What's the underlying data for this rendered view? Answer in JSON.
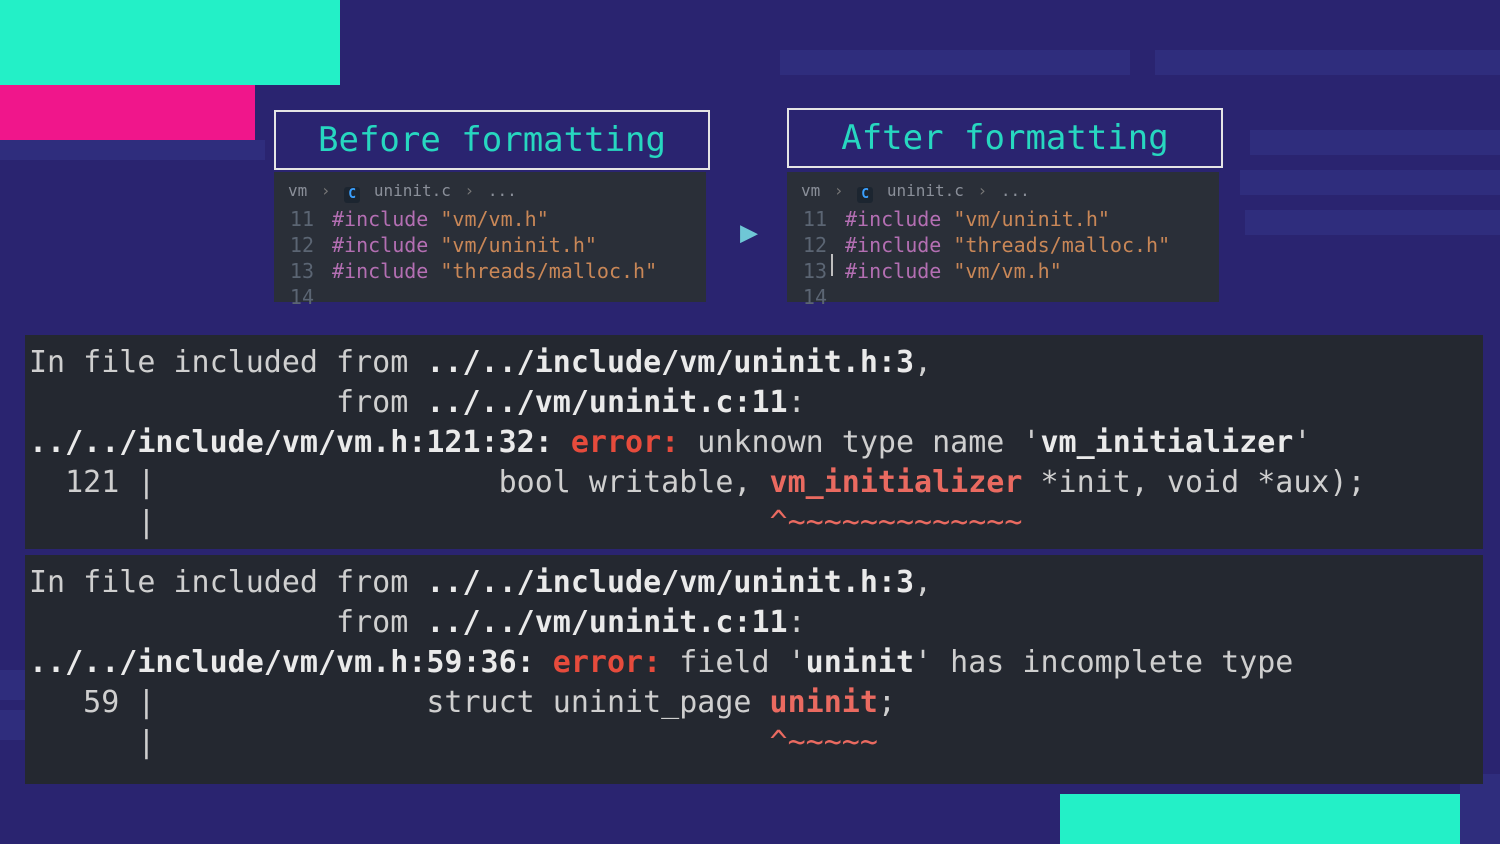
{
  "titles": {
    "before": "Before formatting",
    "after": "After formatting"
  },
  "breadcrumb": {
    "folder": "vm",
    "file": "uninit.c",
    "more": "..."
  },
  "before_code": {
    "lines": [
      {
        "n": "11",
        "inc": "#include",
        "path": "\"vm/vm.h\""
      },
      {
        "n": "12",
        "inc": "#include",
        "path": "\"vm/uninit.h\""
      },
      {
        "n": "13",
        "inc": "#include",
        "path": "\"threads/malloc.h\""
      },
      {
        "n": "14",
        "inc": "",
        "path": ""
      }
    ]
  },
  "after_code": {
    "lines": [
      {
        "n": "11",
        "inc": "#include",
        "path": "\"vm/uninit.h\""
      },
      {
        "n": "12",
        "inc": "#include",
        "path": "\"threads/malloc.h\""
      },
      {
        "n": "13",
        "inc": "#include",
        "path": "\"vm/vm.h\""
      },
      {
        "n": "14",
        "inc": "",
        "path": ""
      }
    ]
  },
  "terminal1": {
    "l1a": "In file included from ",
    "l1b": "../../include/vm/uninit.h:3",
    "l1c": ",",
    "l2a": "                 from ",
    "l2b": "../../vm/uninit.c:11",
    "l2c": ":",
    "l3a": "../../include/vm/vm.h:121:32:",
    "l3err": " error:",
    "l3b": " unknown type name '",
    "l3c": "vm_initializer",
    "l3d": "'",
    "l4a": "  121 |                   bool writable, ",
    "l4b": "vm_initializer",
    "l4c": " *init, void *aux);",
    "l5": "      |                                  ",
    "l5s": "^~~~~~~~~~~~~~"
  },
  "terminal2": {
    "l1a": "In file included from ",
    "l1b": "../../include/vm/uninit.h:3",
    "l1c": ",",
    "l2a": "                 from ",
    "l2b": "../../vm/uninit.c:11",
    "l2c": ":",
    "l3a": "../../include/vm/vm.h:59:36:",
    "l3err": " error:",
    "l3b": " field '",
    "l3c": "uninit",
    "l3d": "' has incomplete type",
    "l4a": "   59 |               struct uninit_page ",
    "l4b": "uninit",
    "l4c": ";",
    "l5": "      |                                  ",
    "l5s": "^~~~~~"
  }
}
